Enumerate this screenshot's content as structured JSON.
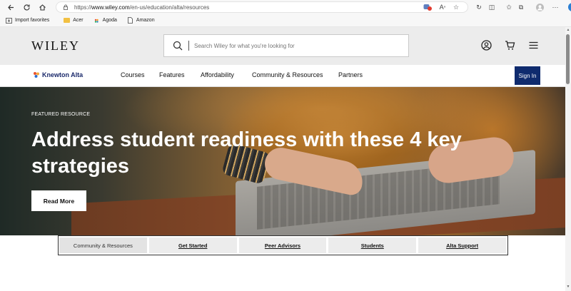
{
  "browser": {
    "url_prefix": "https://",
    "url_domain": "www.wiley.com",
    "url_path": "/en-us/education/alta/resources",
    "bookmarks": [
      {
        "label": "Import favorites",
        "icon": "import-icon"
      },
      {
        "label": "Acer",
        "icon": "folder-icon"
      },
      {
        "label": "Agoda",
        "icon": "agoda-icon"
      },
      {
        "label": "Amazon",
        "icon": "page-icon"
      }
    ]
  },
  "header": {
    "logo": "WILEY",
    "search_placeholder": "Search Wiley for what you're looking for"
  },
  "subnav": {
    "brand": "Knewton Alta",
    "links": [
      "Courses",
      "Features",
      "Affordability",
      "Community & Resources",
      "Partners"
    ],
    "signin": "Sign In"
  },
  "hero": {
    "eyebrow": "FEATURED RESOURCE",
    "headline": "Address student readiness with these 4 key strategies",
    "cta": "Read More"
  },
  "tabs": [
    "Community & Resources",
    "Get Started",
    "Peer Advisors",
    "Students",
    "Alta Support"
  ],
  "colors": {
    "signin_bg": "#0f2b6e",
    "header_bg": "#ececec",
    "brand_navy": "#1b2a6b"
  }
}
